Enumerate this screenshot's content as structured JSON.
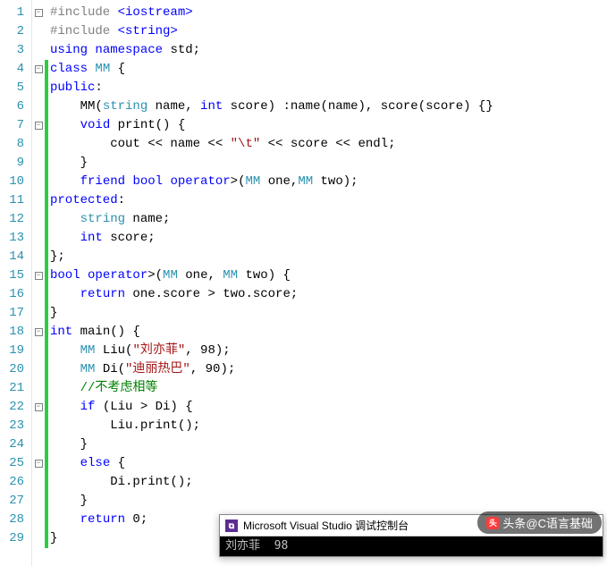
{
  "lineCount": 29,
  "foldMarkers": {
    "1": "minus",
    "4": "minus",
    "7": "minus",
    "15": "minus",
    "18": "minus",
    "22": "minus",
    "25": "minus"
  },
  "changedLines": [
    4,
    5,
    6,
    7,
    8,
    9,
    10,
    11,
    12,
    13,
    14,
    15,
    16,
    17,
    18,
    19,
    20,
    21,
    22,
    23,
    24,
    25,
    26,
    27,
    28,
    29
  ],
  "code": [
    [
      {
        "c": "pp",
        "t": "#include "
      },
      {
        "c": "kw",
        "t": "<iostream>"
      }
    ],
    [
      {
        "c": "pp",
        "t": "#include "
      },
      {
        "c": "kw",
        "t": "<string>"
      }
    ],
    [
      {
        "c": "kw",
        "t": "using"
      },
      {
        "c": "txt",
        "t": " "
      },
      {
        "c": "kw",
        "t": "namespace"
      },
      {
        "c": "txt",
        "t": " std;"
      }
    ],
    [
      {
        "c": "kw",
        "t": "class"
      },
      {
        "c": "txt",
        "t": " "
      },
      {
        "c": "ty",
        "t": "MM"
      },
      {
        "c": "txt",
        "t": " {"
      }
    ],
    [
      {
        "c": "kw",
        "t": "public"
      },
      {
        "c": "txt",
        "t": ":"
      }
    ],
    [
      {
        "c": "txt",
        "t": "    MM("
      },
      {
        "c": "ty",
        "t": "string"
      },
      {
        "c": "txt",
        "t": " name, "
      },
      {
        "c": "kw",
        "t": "int"
      },
      {
        "c": "txt",
        "t": " score) :name(name), score(score) {}"
      }
    ],
    [
      {
        "c": "txt",
        "t": "    "
      },
      {
        "c": "kw",
        "t": "void"
      },
      {
        "c": "txt",
        "t": " print() {"
      }
    ],
    [
      {
        "c": "txt",
        "t": "        cout << name << "
      },
      {
        "c": "str",
        "t": "\"\\t\""
      },
      {
        "c": "txt",
        "t": " << score << endl;"
      }
    ],
    [
      {
        "c": "txt",
        "t": "    }"
      }
    ],
    [
      {
        "c": "txt",
        "t": "    "
      },
      {
        "c": "kw",
        "t": "friend"
      },
      {
        "c": "txt",
        "t": " "
      },
      {
        "c": "kw",
        "t": "bool"
      },
      {
        "c": "txt",
        "t": " "
      },
      {
        "c": "kw",
        "t": "operator"
      },
      {
        "c": "txt",
        "t": ">("
      },
      {
        "c": "ty",
        "t": "MM"
      },
      {
        "c": "txt",
        "t": " one,"
      },
      {
        "c": "ty",
        "t": "MM"
      },
      {
        "c": "txt",
        "t": " two);"
      }
    ],
    [
      {
        "c": "kw",
        "t": "protected"
      },
      {
        "c": "txt",
        "t": ":"
      }
    ],
    [
      {
        "c": "txt",
        "t": "    "
      },
      {
        "c": "ty",
        "t": "string"
      },
      {
        "c": "txt",
        "t": " name;"
      }
    ],
    [
      {
        "c": "txt",
        "t": "    "
      },
      {
        "c": "kw",
        "t": "int"
      },
      {
        "c": "txt",
        "t": " score;"
      }
    ],
    [
      {
        "c": "txt",
        "t": "};"
      }
    ],
    [
      {
        "c": "kw",
        "t": "bool"
      },
      {
        "c": "txt",
        "t": " "
      },
      {
        "c": "kw",
        "t": "operator"
      },
      {
        "c": "txt",
        "t": ">("
      },
      {
        "c": "ty",
        "t": "MM"
      },
      {
        "c": "txt",
        "t": " one, "
      },
      {
        "c": "ty",
        "t": "MM"
      },
      {
        "c": "txt",
        "t": " two) {"
      }
    ],
    [
      {
        "c": "txt",
        "t": "    "
      },
      {
        "c": "kw",
        "t": "return"
      },
      {
        "c": "txt",
        "t": " one.score > two.score;"
      }
    ],
    [
      {
        "c": "txt",
        "t": "}"
      }
    ],
    [
      {
        "c": "kw",
        "t": "int"
      },
      {
        "c": "txt",
        "t": " main() {"
      }
    ],
    [
      {
        "c": "txt",
        "t": "    "
      },
      {
        "c": "ty",
        "t": "MM"
      },
      {
        "c": "txt",
        "t": " Liu("
      },
      {
        "c": "str",
        "t": "\"刘亦菲\""
      },
      {
        "c": "txt",
        "t": ", 98);"
      }
    ],
    [
      {
        "c": "txt",
        "t": "    "
      },
      {
        "c": "ty",
        "t": "MM"
      },
      {
        "c": "txt",
        "t": " Di("
      },
      {
        "c": "str",
        "t": "\"迪丽热巴\""
      },
      {
        "c": "txt",
        "t": ", 90);"
      }
    ],
    [
      {
        "c": "txt",
        "t": "    "
      },
      {
        "c": "cm",
        "t": "//不考虑相等"
      }
    ],
    [
      {
        "c": "txt",
        "t": "    "
      },
      {
        "c": "kw",
        "t": "if"
      },
      {
        "c": "txt",
        "t": " (Liu > Di) {"
      }
    ],
    [
      {
        "c": "txt",
        "t": "        Liu.print();"
      }
    ],
    [
      {
        "c": "txt",
        "t": "    }"
      }
    ],
    [
      {
        "c": "txt",
        "t": "    "
      },
      {
        "c": "kw",
        "t": "else"
      },
      {
        "c": "txt",
        "t": " {"
      }
    ],
    [
      {
        "c": "txt",
        "t": "        Di.print();"
      }
    ],
    [
      {
        "c": "txt",
        "t": "    }"
      }
    ],
    [
      {
        "c": "txt",
        "t": "    "
      },
      {
        "c": "kw",
        "t": "return"
      },
      {
        "c": "txt",
        "t": " 0;"
      }
    ],
    [
      {
        "c": "txt",
        "t": "}"
      }
    ]
  ],
  "console": {
    "title": "Microsoft Visual Studio 调试控制台",
    "output": "刘亦菲  98"
  },
  "watermark": {
    "text": "头条@C语言基础",
    "logoText": "头"
  }
}
